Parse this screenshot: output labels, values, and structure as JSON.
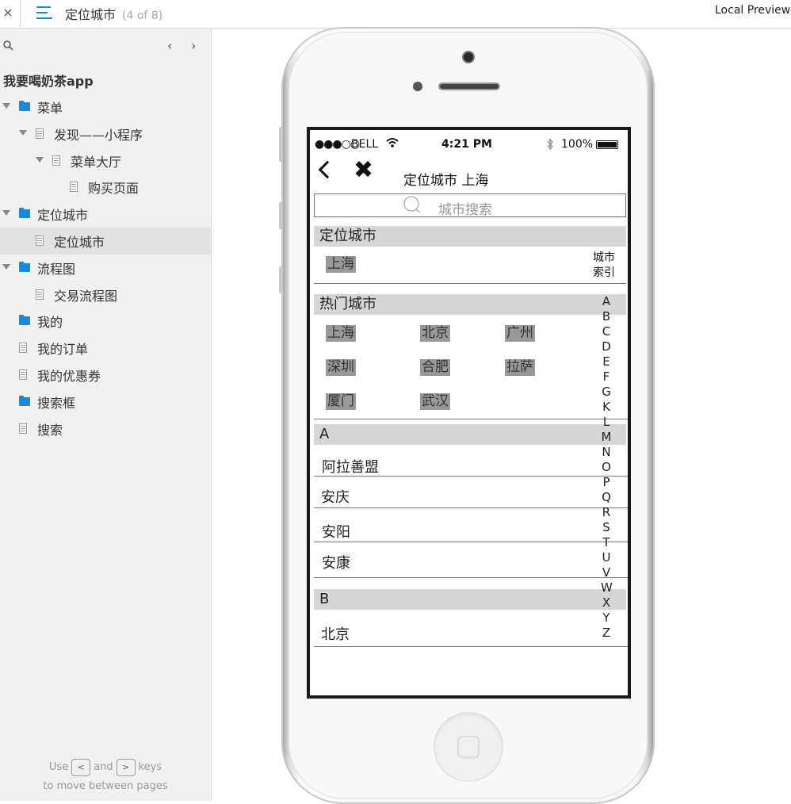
{
  "topbar": {
    "close_glyph": "×",
    "menu_icon": "list-icon",
    "title": "定位城市",
    "page_count": "(4 of 8)",
    "preview_label": "Local Preview"
  },
  "sidebar": {
    "project_title": "我要喝奶茶app",
    "prev_glyph": "‹",
    "next_glyph": "›",
    "tree": [
      {
        "label": "菜单",
        "type": "folder",
        "expanded": true
      },
      {
        "label": "发现——小程序",
        "type": "page",
        "expanded": true
      },
      {
        "label": "菜单大厅",
        "type": "page",
        "expanded": true
      },
      {
        "label": "购买页面",
        "type": "page"
      },
      {
        "label": "定位城市",
        "type": "folder",
        "expanded": true
      },
      {
        "label": "定位城市",
        "type": "page",
        "selected": true
      },
      {
        "label": "流程图",
        "type": "folder",
        "expanded": true
      },
      {
        "label": "交易流程图",
        "type": "page"
      },
      {
        "label": "我的",
        "type": "folder"
      },
      {
        "label": "我的订单",
        "type": "page"
      },
      {
        "label": "我的优惠券",
        "type": "page"
      },
      {
        "label": "搜索框",
        "type": "folder"
      },
      {
        "label": "搜索",
        "type": "page"
      }
    ],
    "hint": {
      "use": "Use",
      "key_prev": "<",
      "and": "and",
      "key_next": ">",
      "keys": "keys",
      "line2": "to move between pages"
    }
  },
  "phone": {
    "status": {
      "signal": "●●●○○",
      "carrier": "BELL",
      "wifi": "wifi-icon",
      "time": "4:21 PM",
      "bluetooth": "bluetooth-icon",
      "battery": "100%"
    },
    "nav": {
      "title": "定位城市 上海",
      "back_icon": "back-chevron-icon",
      "close_icon": "close-x-icon"
    },
    "search_placeholder": "城市搜索",
    "located_section": "定位城市",
    "located_city": "上海",
    "index_header": "城市\n索引",
    "hot_section": "热门城市",
    "hot_cities": [
      "上海",
      "北京",
      "广州",
      "深圳",
      "合肥",
      "拉萨",
      "厦门",
      "武汉"
    ],
    "groups": [
      {
        "letter": "A",
        "cities": [
          "阿拉善盟",
          "安庆",
          "安阳",
          "安康"
        ]
      },
      {
        "letter": "B",
        "cities": [
          "北京"
        ]
      }
    ],
    "index_letters": [
      "A",
      "B",
      "C",
      "D",
      "E",
      "F",
      "G",
      "K",
      "L",
      "M",
      "N",
      "O",
      "P",
      "Q",
      "R",
      "S",
      "T",
      "U",
      "V",
      "W",
      "X",
      "Y",
      "Z"
    ]
  }
}
